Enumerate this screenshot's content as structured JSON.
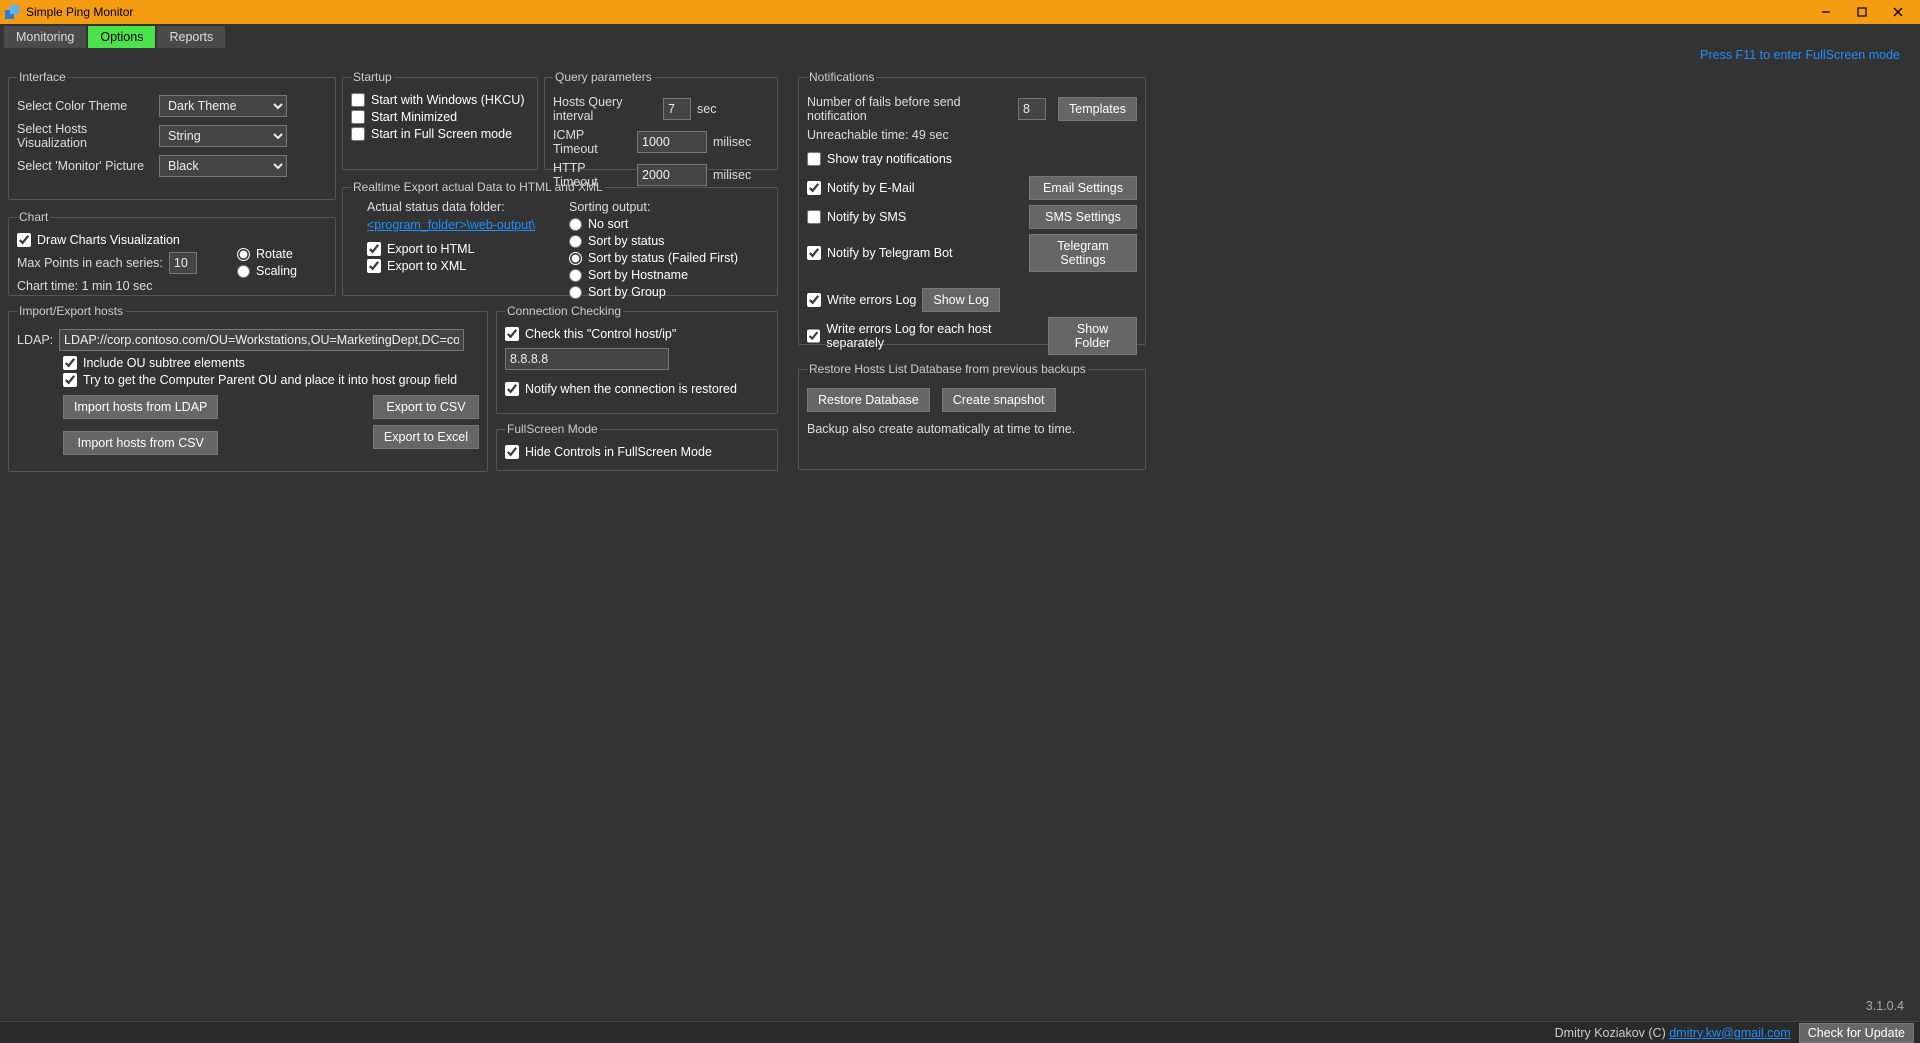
{
  "window": {
    "title": "Simple Ping Monitor"
  },
  "tabs": {
    "monitoring": "Monitoring",
    "options": "Options",
    "reports": "Reports"
  },
  "fs_hint": "Press F11 to enter FullScreen mode",
  "interface": {
    "legend": "Interface",
    "theme_label": "Select Color Theme",
    "theme_value": "Dark Theme",
    "hosts_label": "Select Hosts Visualization",
    "hosts_value": "String",
    "picture_label": "Select 'Monitor' Picture",
    "picture_value": "Black"
  },
  "chart": {
    "legend": "Chart",
    "draw": "Draw Charts Visualization",
    "max_label": "Max Points in each series:",
    "max_value": "10",
    "rotate": "Rotate",
    "scaling": "Scaling",
    "time": "Chart time: 1 min 10 sec"
  },
  "startup": {
    "legend": "Startup",
    "win": "Start with Windows (HKCU)",
    "min": "Start Minimized",
    "fs": "Start in Full Screen mode"
  },
  "query": {
    "legend": "Query parameters",
    "interval_label": "Hosts Query interval",
    "interval_value": "7",
    "sec": "sec",
    "icmp_label": "ICMP Timeout",
    "icmp_value": "1000",
    "ms": "milisec",
    "http_label": "HTTP Timeout",
    "http_value": "2000"
  },
  "realtime": {
    "legend": "Realtime Export actual Data to HTML and XML",
    "folder_label": "Actual status data folder:",
    "folder_link": "<program_folder>\\web-output\\",
    "export_html": "Export to HTML",
    "export_xml": "Export to XML",
    "sort_label": "Sorting output:",
    "s0": "No sort",
    "s1": "Sort by status",
    "s2": "Sort by status (Failed First)",
    "s3": "Sort by Hostname",
    "s4": "Sort by Group"
  },
  "import": {
    "legend": "Import/Export hosts",
    "ldap_label": "LDAP:",
    "ldap_value": "LDAP://corp.contoso.com/OU=Workstations,OU=MarketingDept,DC=corp,DC",
    "include_ou": "Include OU subtree elements",
    "parent_ou": "Try to get the Computer Parent OU and place it into host group field",
    "btn_ldap": "Import hosts from LDAP",
    "btn_csv": "Import hosts from CSV",
    "btn_exp_csv": "Export to CSV",
    "btn_exp_excel": "Export to Excel"
  },
  "conn": {
    "legend": "Connection Checking",
    "check": "Check this \"Control host/ip\"",
    "value": "8.8.8.8",
    "notify": "Notify when the connection is restored"
  },
  "fullscreen": {
    "legend": "FullScreen Mode",
    "hide": "Hide Controls in FullScreen Mode"
  },
  "notif": {
    "legend": "Notifications",
    "fails_label": "Number of fails before send notification",
    "fails_value": "8",
    "templates": "Templates",
    "unreach": "Unreachable time: 49 sec",
    "tray": "Show tray notifications",
    "email": "Notify by E-Mail",
    "email_btn": "Email Settings",
    "sms": "Notify by SMS",
    "sms_btn": "SMS Settings",
    "telegram": "Notify by Telegram Bot",
    "telegram_btn": "Telegram Settings",
    "log": "Write errors Log",
    "log_btn": "Show Log",
    "log_each": "Write errors Log for each host separately",
    "folder_btn": "Show Folder"
  },
  "restore": {
    "legend": "Restore Hosts List Database from previous backups",
    "btn_restore": "Restore Database",
    "btn_snapshot": "Create snapshot",
    "note": "Backup also create automatically at time to time."
  },
  "version": "3.1.0.4",
  "footer": {
    "credit": "Dmitry Koziakov (C) ",
    "email": "dmitry.kw@gmail.com",
    "update": "Check for Update"
  }
}
